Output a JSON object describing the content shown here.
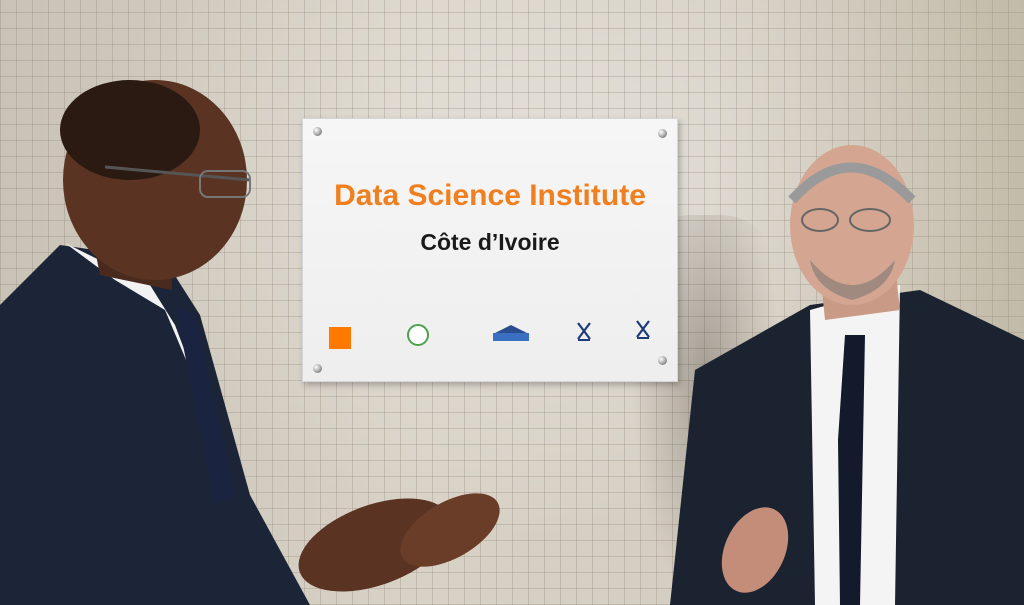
{
  "plaque": {
    "title": "Data Science Institute",
    "subtitle": "Côte d’Ivoire",
    "title_color": "#f07f1f",
    "logos": [
      "orange-logo",
      "circle-logo",
      "ensea-logo",
      "x-logo",
      "x-logo"
    ]
  },
  "colors": {
    "wall": "#d4cec2",
    "suit": "#1c2538",
    "plaque": "#f2f2f2"
  }
}
